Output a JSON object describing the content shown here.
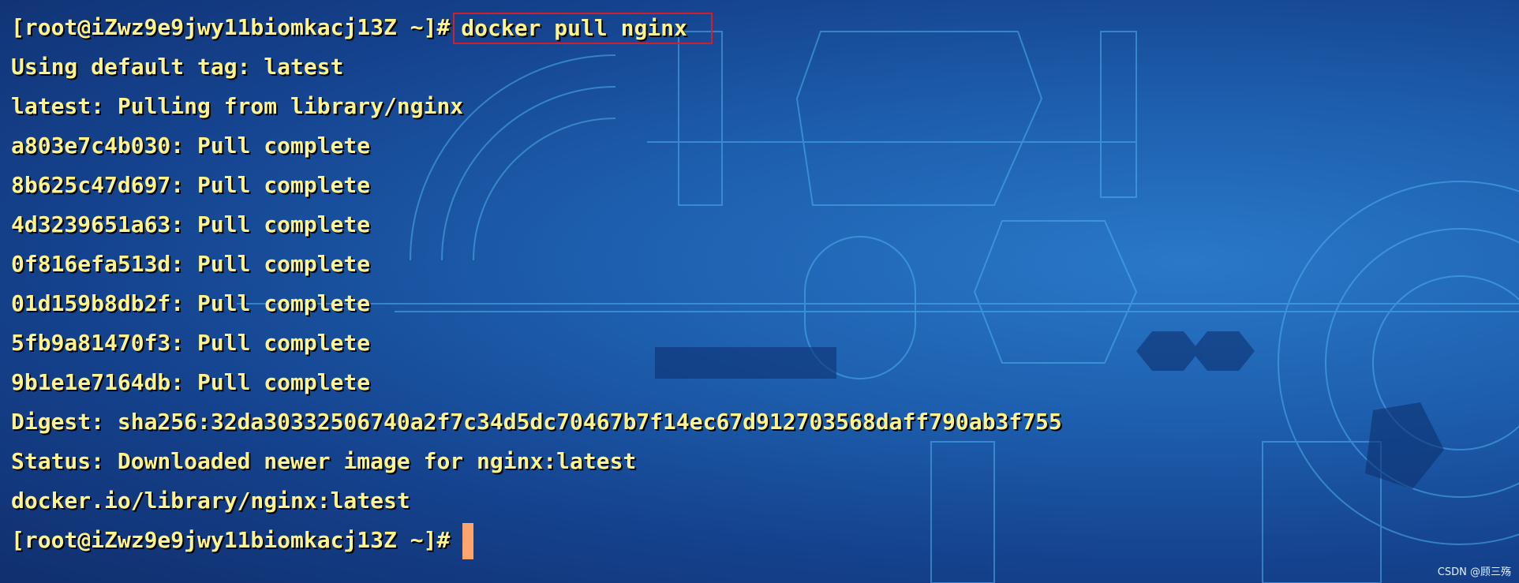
{
  "terminal": {
    "prompt": "[root@iZwz9e9jwy11biomkacj13Z ~]#",
    "command": "docker pull nginx",
    "output": [
      "Using default tag: latest",
      "latest: Pulling from library/nginx",
      "a803e7c4b030: Pull complete",
      "8b625c47d697: Pull complete",
      "4d3239651a63: Pull complete",
      "0f816efa513d: Pull complete",
      "01d159b8db2f: Pull complete",
      "5fb9a81470f3: Pull complete",
      "9b1e1e7164db: Pull complete",
      "Digest: sha256:32da30332506740a2f7c34d5dc70467b7f14ec67d912703568daff790ab3f755",
      "Status: Downloaded newer image for nginx:latest",
      "docker.io/library/nginx:latest"
    ],
    "final_prompt": "[root@iZwz9e9jwy11biomkacj13Z ~]#"
  },
  "watermark": "CSDN @顾三殇",
  "colors": {
    "text": "#fff48a",
    "highlight_border": "#d2202a",
    "cursor": "#ffa46a"
  }
}
